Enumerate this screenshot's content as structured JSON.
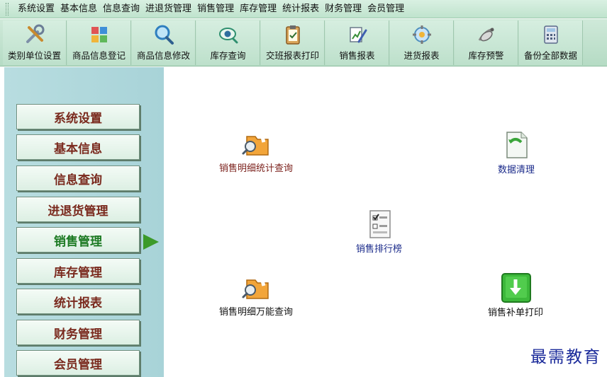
{
  "menubar": {
    "items": [
      "系统设置",
      "基本信息",
      "信息查询",
      "进退货管理",
      "销售管理",
      "库存管理",
      "统计报表",
      "财务管理",
      "会员管理"
    ]
  },
  "toolbar": {
    "items": [
      {
        "label": "类别单位设置",
        "icon": "tools-icon"
      },
      {
        "label": "商品信息登记",
        "icon": "puzzle-icon"
      },
      {
        "label": "商品信息修改",
        "icon": "magnifier-icon"
      },
      {
        "label": "库存查询",
        "icon": "eye-search-icon"
      },
      {
        "label": "交班报表打印",
        "icon": "clipboard-icon"
      },
      {
        "label": "销售报表",
        "icon": "pen-chart-icon"
      },
      {
        "label": "进货报表",
        "icon": "gear-globe-icon"
      },
      {
        "label": "库存预警",
        "icon": "satellite-icon"
      },
      {
        "label": "备份全部数据",
        "icon": "calculator-icon"
      }
    ]
  },
  "sidebar": {
    "items": [
      "系统设置",
      "基本信息",
      "信息查询",
      "进退货管理",
      "销售管理",
      "库存管理",
      "统计报表",
      "财务管理",
      "会员管理"
    ],
    "active_index": 4
  },
  "main": {
    "items": [
      {
        "label": "销售明细统计查询",
        "icon": "folder-search-icon"
      },
      {
        "label": "数据清理",
        "icon": "document-recycle-icon"
      },
      {
        "label": "销售排行榜",
        "icon": "checklist-document-icon"
      },
      {
        "label": "销售明细万能查询",
        "icon": "folder-search-icon"
      },
      {
        "label": "销售补单打印",
        "icon": "green-download-icon"
      }
    ]
  },
  "watermark": "最需教育",
  "colors": {
    "menubar_bg": "#bfe3cd",
    "sidebar_bg": "#a8d3d8",
    "sidebar_text": "#7a2a1e",
    "sidebar_active_text": "#1c7a23",
    "arrow": "#3c9a2a",
    "watermark": "#1a2a9a"
  }
}
